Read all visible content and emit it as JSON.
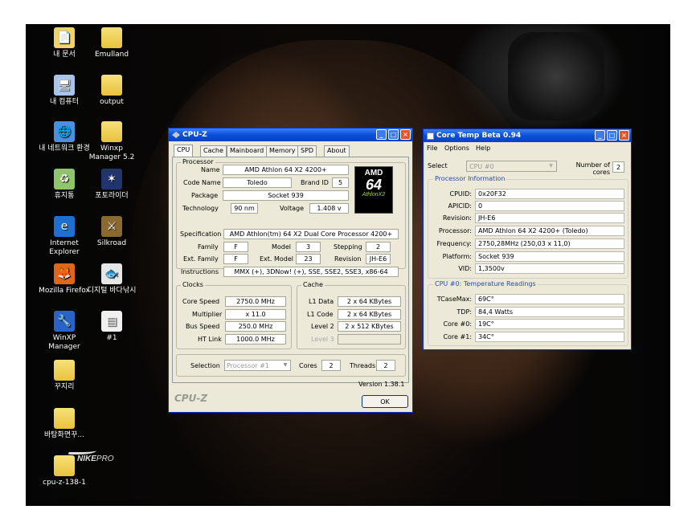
{
  "desktop_icons": [
    {
      "label": "내 문서",
      "icon": "my-documents-icon"
    },
    {
      "label": "Emulland",
      "icon": "folder-icon"
    },
    {
      "label": "내 컴퓨터",
      "icon": "my-computer-icon"
    },
    {
      "label": "output",
      "icon": "folder-icon"
    },
    {
      "label": "내 네트워크 환경",
      "icon": "network-icon"
    },
    {
      "label": "Winxp Manager 5.2",
      "icon": "folder-icon"
    },
    {
      "label": "휴지통",
      "icon": "recycle-bin-icon"
    },
    {
      "label": "포토라이더",
      "icon": "photoscape-icon"
    },
    {
      "label": "Internet Explorer",
      "icon": "ie-icon"
    },
    {
      "label": "Silkroad",
      "icon": "silkroad-icon"
    },
    {
      "label": "Mozilla Firefox",
      "icon": "firefox-icon"
    },
    {
      "label": "디지털 바다낚시",
      "icon": "fishing-icon"
    },
    {
      "label": "WinXP Manager",
      "icon": "winxp-manager-icon"
    },
    {
      "label": "#1",
      "icon": "document-icon"
    },
    {
      "label": "꾸지리",
      "icon": "folder-icon"
    },
    {
      "label": "바탕화면꾸...",
      "icon": "folder-icon"
    },
    {
      "label": "cpu-z-138-1",
      "icon": "folder-icon"
    }
  ],
  "wallpaper_logo": {
    "brand": "NIKE",
    "suffix": "PRO"
  },
  "cpuz": {
    "title": "CPU-Z",
    "tabs": [
      "CPU",
      "Cache",
      "Mainboard",
      "Memory",
      "SPD",
      "About"
    ],
    "processor_group": "Processor",
    "name_label": "Name",
    "name": "AMD Athlon 64 X2 4200+",
    "codename_label": "Code Name",
    "codename": "Toledo",
    "brandid_label": "Brand ID",
    "brandid": "5",
    "package_label": "Package",
    "package": "Socket 939",
    "technology_label": "Technology",
    "technology": "90 nm",
    "voltage_label": "Voltage",
    "voltage": "1.408 v",
    "spec_label": "Specification",
    "spec": "AMD Athlon(tm) 64 X2 Dual Core Processor 4200+",
    "family_label": "Family",
    "family": "F",
    "model_label": "Model",
    "model": "3",
    "stepping_label": "Stepping",
    "stepping": "2",
    "extfamily_label": "Ext. Family",
    "extfamily": "F",
    "extmodel_label": "Ext. Model",
    "extmodel": "23",
    "revision_label": "Revision",
    "revision": "JH-E6",
    "instructions_label": "Instructions",
    "instructions": "MMX (+), 3DNow! (+), SSE, SSE2, SSE3, x86-64",
    "clocks_group": "Clocks",
    "corespeed_label": "Core Speed",
    "corespeed": "2750.0 MHz",
    "multiplier_label": "Multiplier",
    "multiplier": "x 11.0",
    "busspeed_label": "Bus Speed",
    "busspeed": "250.0 MHz",
    "htlink_label": "HT Link",
    "htlink": "1000.0 MHz",
    "cache_group": "Cache",
    "l1data_label": "L1 Data",
    "l1data": "2 x 64 KBytes",
    "l1code_label": "L1 Code",
    "l1code": "2 x 64 KBytes",
    "level2_label": "Level 2",
    "level2": "2 x 512 KBytes",
    "level3_label": "Level 3",
    "level3": "",
    "selection_label": "Selection",
    "selection": "Processor #1",
    "cores_label": "Cores",
    "cores": "2",
    "threads_label": "Threads",
    "threads": "2",
    "version": "Version 1.38.1",
    "brand_footer": "CPU-Z",
    "ok": "OK",
    "logo_brand": "AMD",
    "logo_num": "64",
    "logo_sub": "AthlonX2"
  },
  "coretemp": {
    "title": "Core Temp Beta 0.94",
    "menu": [
      "File",
      "Options",
      "Help"
    ],
    "select_cpu_label": "Select CPU:",
    "select_cpu": "CPU #0",
    "num_cores_label": "Number of cores",
    "num_cores": "2",
    "proc_info_group": "Processor Information",
    "rows": [
      {
        "label": "CPUID:",
        "value": "0x20F32"
      },
      {
        "label": "APICID:",
        "value": "0"
      },
      {
        "label": "Revision:",
        "value": "JH-E6"
      },
      {
        "label": "Processor:",
        "value": "AMD Athlon 64 X2 4200+ (Toledo)"
      },
      {
        "label": "Frequency:",
        "value": "2750,28MHz (250,03 x 11,0)"
      },
      {
        "label": "Platform:",
        "value": "Socket 939"
      },
      {
        "label": "VID:",
        "value": "1,3500v"
      }
    ],
    "temp_group": "CPU #0: Temperature Readings",
    "temps": [
      {
        "label": "TCaseMax:",
        "value": "69C°"
      },
      {
        "label": "TDP:",
        "value": "84,4 Watts"
      },
      {
        "label": "Core #0:",
        "value": "19C°"
      },
      {
        "label": "Core #1:",
        "value": "34C°"
      }
    ]
  }
}
